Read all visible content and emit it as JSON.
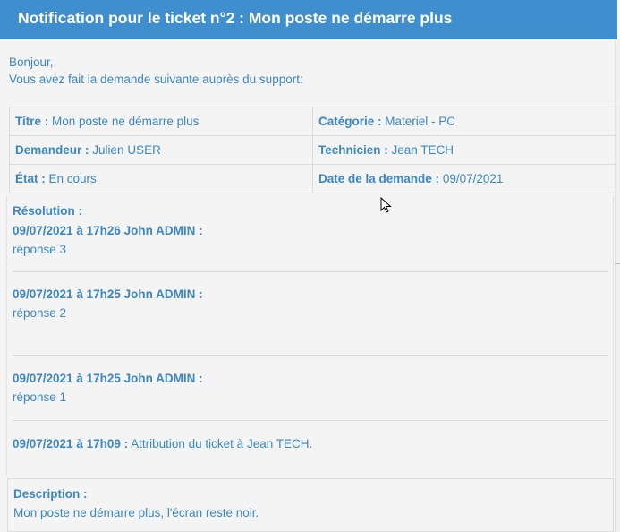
{
  "header": {
    "title": "Notification pour le ticket n°2 : Mon poste ne démarre plus"
  },
  "greeting": {
    "line1": "Bonjour,",
    "line2": "Vous avez fait la demande suivante auprès du support:"
  },
  "ticket": {
    "title_label": "Titre :",
    "title_value": "Mon poste ne démarre plus",
    "category_label": "Catégorie :",
    "category_value": "Materiel - PC",
    "requester_label": "Demandeur :",
    "requester_value": "Julien USER",
    "technician_label": "Technicien :",
    "technician_value": "Jean TECH",
    "state_label": "État :",
    "state_value": "En cours",
    "date_label": "Date de la demande :",
    "date_value": "09/07/2021"
  },
  "resolution": {
    "title": "Résolution :",
    "followups": [
      {
        "header": "09/07/2021 à 17h26 John ADMIN :",
        "content": "réponse 3"
      },
      {
        "header": "09/07/2021 à 17h25 John ADMIN :",
        "content": "réponse 2"
      },
      {
        "header": "09/07/2021 à 17h25 John ADMIN :",
        "content": "réponse 1"
      },
      {
        "header": "09/07/2021 à 17h09 :",
        "content": "Attribution du ticket à Jean TECH."
      }
    ]
  },
  "description": {
    "title": "Description :",
    "text": "Mon poste ne démarre plus, l'écran reste noir."
  },
  "colors": {
    "header_bg": "#3f8fce",
    "accent_text": "#3b87c3",
    "page_bg": "#f4f4f4"
  }
}
